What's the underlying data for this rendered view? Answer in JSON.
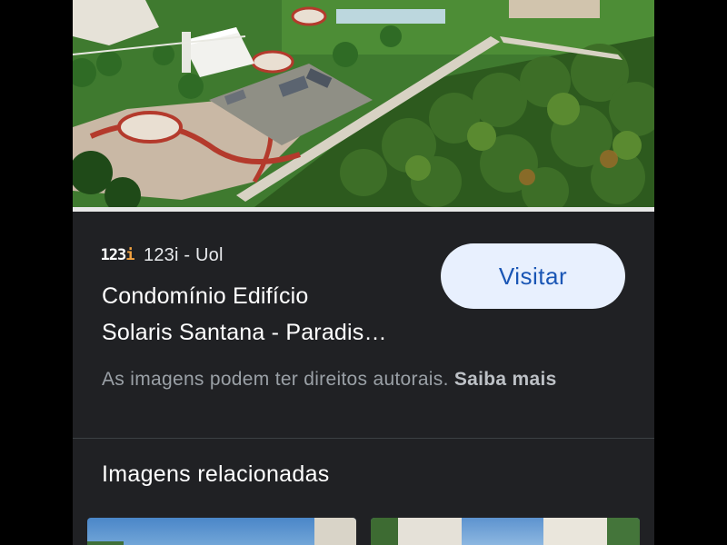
{
  "result": {
    "source_name": "123i - Uol",
    "source_logo": {
      "digits": "123",
      "letter": "i"
    },
    "title_line1": "Condomínio Edifício",
    "title_line2": "Solaris Santana - Paradis…",
    "visit_label": "Visitar",
    "copyright_text": "As imagens podem ter direitos autorais.",
    "learn_more_label": "Saiba mais"
  },
  "related": {
    "title": "Imagens relacionadas"
  },
  "colors": {
    "background": "#202124",
    "button_bg": "#e8f0fe",
    "button_text": "#1a56b5",
    "muted_text": "#9aa0a6"
  }
}
